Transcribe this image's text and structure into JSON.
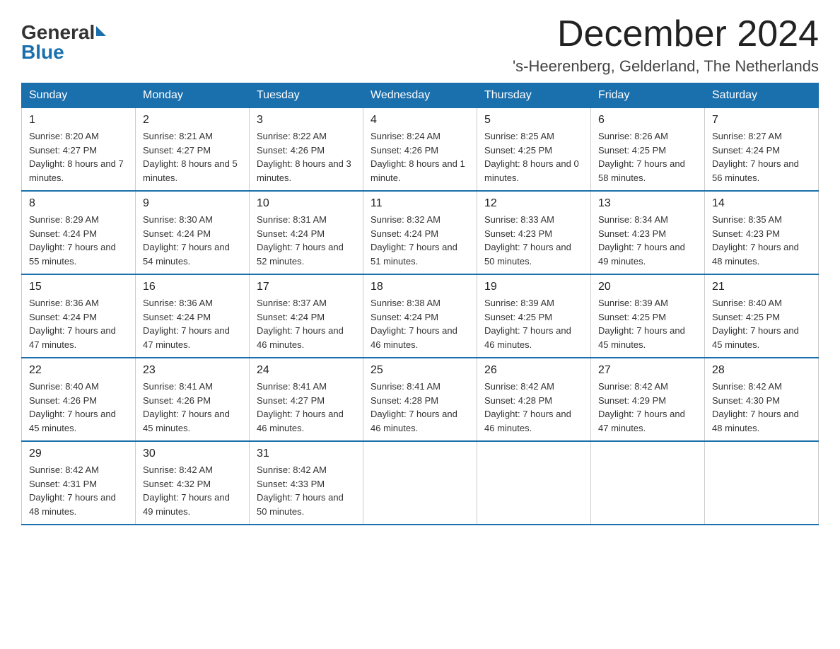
{
  "logo": {
    "general": "General",
    "blue": "Blue"
  },
  "title": "December 2024",
  "location": "'s-Heerenberg, Gelderland, The Netherlands",
  "days_of_week": [
    "Sunday",
    "Monday",
    "Tuesday",
    "Wednesday",
    "Thursday",
    "Friday",
    "Saturday"
  ],
  "weeks": [
    [
      {
        "day": "1",
        "sunrise": "8:20 AM",
        "sunset": "4:27 PM",
        "daylight": "8 hours and 7 minutes."
      },
      {
        "day": "2",
        "sunrise": "8:21 AM",
        "sunset": "4:27 PM",
        "daylight": "8 hours and 5 minutes."
      },
      {
        "day": "3",
        "sunrise": "8:22 AM",
        "sunset": "4:26 PM",
        "daylight": "8 hours and 3 minutes."
      },
      {
        "day": "4",
        "sunrise": "8:24 AM",
        "sunset": "4:26 PM",
        "daylight": "8 hours and 1 minute."
      },
      {
        "day": "5",
        "sunrise": "8:25 AM",
        "sunset": "4:25 PM",
        "daylight": "8 hours and 0 minutes."
      },
      {
        "day": "6",
        "sunrise": "8:26 AM",
        "sunset": "4:25 PM",
        "daylight": "7 hours and 58 minutes."
      },
      {
        "day": "7",
        "sunrise": "8:27 AM",
        "sunset": "4:24 PM",
        "daylight": "7 hours and 56 minutes."
      }
    ],
    [
      {
        "day": "8",
        "sunrise": "8:29 AM",
        "sunset": "4:24 PM",
        "daylight": "7 hours and 55 minutes."
      },
      {
        "day": "9",
        "sunrise": "8:30 AM",
        "sunset": "4:24 PM",
        "daylight": "7 hours and 54 minutes."
      },
      {
        "day": "10",
        "sunrise": "8:31 AM",
        "sunset": "4:24 PM",
        "daylight": "7 hours and 52 minutes."
      },
      {
        "day": "11",
        "sunrise": "8:32 AM",
        "sunset": "4:24 PM",
        "daylight": "7 hours and 51 minutes."
      },
      {
        "day": "12",
        "sunrise": "8:33 AM",
        "sunset": "4:23 PM",
        "daylight": "7 hours and 50 minutes."
      },
      {
        "day": "13",
        "sunrise": "8:34 AM",
        "sunset": "4:23 PM",
        "daylight": "7 hours and 49 minutes."
      },
      {
        "day": "14",
        "sunrise": "8:35 AM",
        "sunset": "4:23 PM",
        "daylight": "7 hours and 48 minutes."
      }
    ],
    [
      {
        "day": "15",
        "sunrise": "8:36 AM",
        "sunset": "4:24 PM",
        "daylight": "7 hours and 47 minutes."
      },
      {
        "day": "16",
        "sunrise": "8:36 AM",
        "sunset": "4:24 PM",
        "daylight": "7 hours and 47 minutes."
      },
      {
        "day": "17",
        "sunrise": "8:37 AM",
        "sunset": "4:24 PM",
        "daylight": "7 hours and 46 minutes."
      },
      {
        "day": "18",
        "sunrise": "8:38 AM",
        "sunset": "4:24 PM",
        "daylight": "7 hours and 46 minutes."
      },
      {
        "day": "19",
        "sunrise": "8:39 AM",
        "sunset": "4:25 PM",
        "daylight": "7 hours and 46 minutes."
      },
      {
        "day": "20",
        "sunrise": "8:39 AM",
        "sunset": "4:25 PM",
        "daylight": "7 hours and 45 minutes."
      },
      {
        "day": "21",
        "sunrise": "8:40 AM",
        "sunset": "4:25 PM",
        "daylight": "7 hours and 45 minutes."
      }
    ],
    [
      {
        "day": "22",
        "sunrise": "8:40 AM",
        "sunset": "4:26 PM",
        "daylight": "7 hours and 45 minutes."
      },
      {
        "day": "23",
        "sunrise": "8:41 AM",
        "sunset": "4:26 PM",
        "daylight": "7 hours and 45 minutes."
      },
      {
        "day": "24",
        "sunrise": "8:41 AM",
        "sunset": "4:27 PM",
        "daylight": "7 hours and 46 minutes."
      },
      {
        "day": "25",
        "sunrise": "8:41 AM",
        "sunset": "4:28 PM",
        "daylight": "7 hours and 46 minutes."
      },
      {
        "day": "26",
        "sunrise": "8:42 AM",
        "sunset": "4:28 PM",
        "daylight": "7 hours and 46 minutes."
      },
      {
        "day": "27",
        "sunrise": "8:42 AM",
        "sunset": "4:29 PM",
        "daylight": "7 hours and 47 minutes."
      },
      {
        "day": "28",
        "sunrise": "8:42 AM",
        "sunset": "4:30 PM",
        "daylight": "7 hours and 48 minutes."
      }
    ],
    [
      {
        "day": "29",
        "sunrise": "8:42 AM",
        "sunset": "4:31 PM",
        "daylight": "7 hours and 48 minutes."
      },
      {
        "day": "30",
        "sunrise": "8:42 AM",
        "sunset": "4:32 PM",
        "daylight": "7 hours and 49 minutes."
      },
      {
        "day": "31",
        "sunrise": "8:42 AM",
        "sunset": "4:33 PM",
        "daylight": "7 hours and 50 minutes."
      },
      null,
      null,
      null,
      null
    ]
  ],
  "labels": {
    "sunrise": "Sunrise:",
    "sunset": "Sunset:",
    "daylight": "Daylight:"
  }
}
